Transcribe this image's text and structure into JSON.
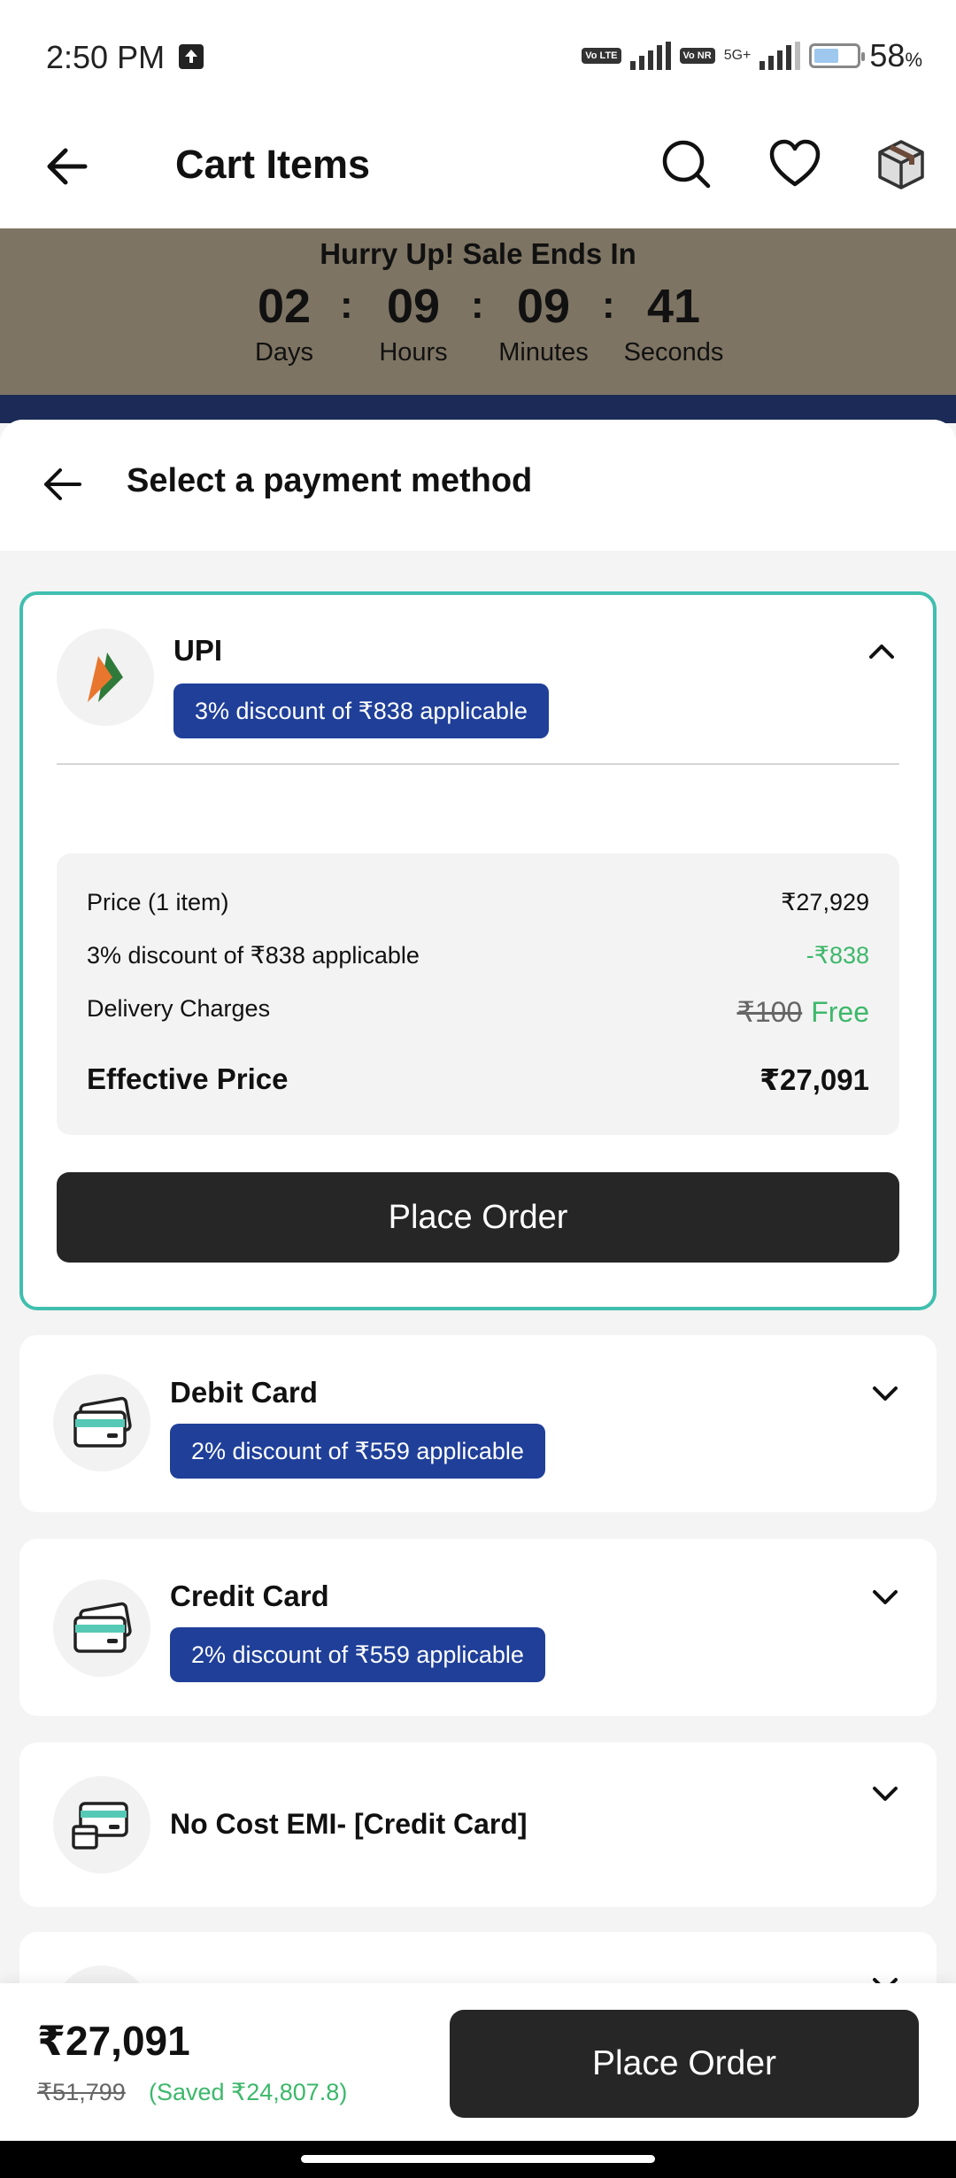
{
  "status_bar": {
    "time": "2:50 PM",
    "chip_volte": "Vo LTE",
    "chip_vonr": "Vo NR",
    "network": "5G+",
    "battery_level": 0.58,
    "battery_percent": "58",
    "battery_unit": "%"
  },
  "header": {
    "title": "Cart Items",
    "icons": [
      "back-arrow-icon",
      "search-icon",
      "heart-icon",
      "box-icon"
    ]
  },
  "sale": {
    "title": "Hurry Up! Sale Ends In",
    "countdown": [
      {
        "value": "02",
        "label": "Days"
      },
      {
        "value": "09",
        "label": "Hours"
      },
      {
        "value": "09",
        "label": "Minutes"
      },
      {
        "value": "41",
        "label": "Seconds"
      }
    ],
    "separator": ":"
  },
  "sheet": {
    "title": "Select a payment method"
  },
  "methods": {
    "upi": {
      "name": "UPI",
      "badge": "3% discount of ₹838 applicable",
      "price_rows": {
        "price_label": "Price (1 item)",
        "price_value": "₹27,929",
        "discount_label": "3% discount of ₹838 applicable",
        "discount_value": "-₹838",
        "delivery_label": "Delivery Charges",
        "delivery_original": "₹100",
        "delivery_value": "Free",
        "effective_label": "Effective Price",
        "effective_value": "₹27,091"
      },
      "place_order": "Place Order"
    },
    "debit": {
      "name": "Debit Card",
      "badge": "2% discount of ₹559 applicable"
    },
    "credit": {
      "name": "Credit Card",
      "badge": "2% discount of ₹559 applicable"
    },
    "emi": {
      "name": "No Cost EMI- [Credit Card]"
    }
  },
  "bottom_bar": {
    "total": "₹27,091",
    "mrp": "₹51,799",
    "saved": "(Saved ₹24,807.8)",
    "place_order": "Place Order"
  },
  "colors": {
    "accent_teal": "#40bfae",
    "badge_blue": "#1f3f99",
    "green": "#3db86b",
    "banner": "#7e7463",
    "dark_button": "#262626"
  }
}
